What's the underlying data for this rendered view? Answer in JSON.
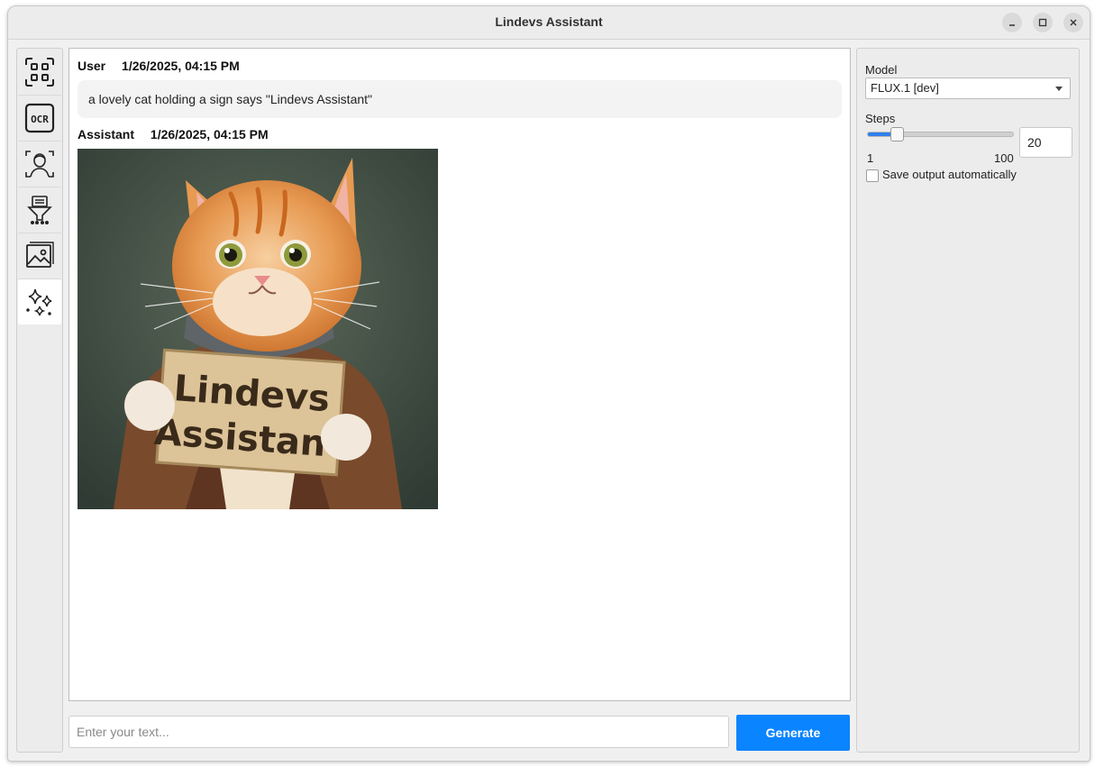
{
  "window": {
    "title": "Lindevs Assistant"
  },
  "sidebar": {
    "items": [
      {
        "icon": "qr-scan-icon"
      },
      {
        "icon": "ocr-icon"
      },
      {
        "icon": "face-scan-icon"
      },
      {
        "icon": "document-filter-icon"
      },
      {
        "icon": "image-icon"
      },
      {
        "icon": "sparkles-icon",
        "active": true
      }
    ]
  },
  "chat": {
    "messages": [
      {
        "author": "User",
        "time": "1/26/2025, 04:15 PM",
        "text": "a lovely cat holding a sign says \"Lindevs Assistant\""
      },
      {
        "author": "Assistant",
        "time": "1/26/2025, 04:15 PM",
        "image": {
          "sign_line1": "Lindevs",
          "sign_line2": "Assistant"
        }
      }
    ]
  },
  "composer": {
    "placeholder": "Enter your text...",
    "value": "",
    "generate_label": "Generate"
  },
  "settings": {
    "model_label": "Model",
    "model_value": "FLUX.1 [dev]",
    "steps_label": "Steps",
    "steps_min": "1",
    "steps_max": "100",
    "steps_value": "20",
    "steps_fraction": 0.19,
    "autosave_label": "Save output automatically",
    "autosave_checked": false
  },
  "colors": {
    "accent": "#0a84ff",
    "slider_fill": "#2f80ed"
  }
}
